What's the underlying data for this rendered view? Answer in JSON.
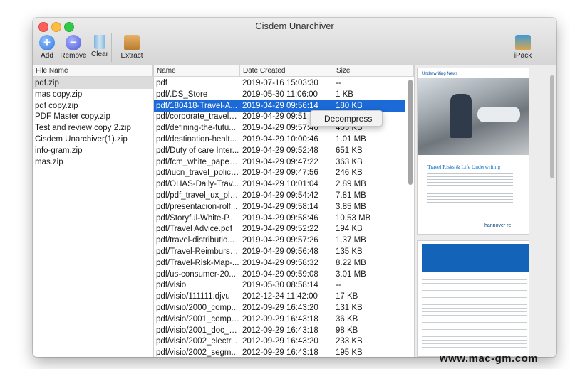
{
  "window": {
    "title": "Cisdem Unarchiver"
  },
  "toolbar": {
    "add_label": "Add",
    "remove_label": "Remove",
    "clear_label": "Clear",
    "extract_label": "Extract",
    "ipack_label": "iPack",
    "add_glyph": "+",
    "remove_glyph": "−"
  },
  "left": {
    "header": "File Name",
    "items": [
      "pdf.zip",
      "mas copy.zip",
      "pdf copy.zip",
      "PDF Master copy.zip",
      "Test and review copy 2.zip",
      "Cisdem Unarchiver(1).zip",
      "info-gram.zip",
      "mas.zip"
    ]
  },
  "table": {
    "headers": {
      "name": "Name",
      "date": "Date Created",
      "size": "Size"
    },
    "rows": [
      [
        "pdf",
        "2019-07-16 15:03:30",
        "--"
      ],
      [
        "pdf/.DS_Store",
        "2019-05-30 11:06:00",
        "1 KB"
      ],
      [
        "pdf/180418-Travel-A...",
        "2019-04-29 09:56:14",
        "180 KB"
      ],
      [
        "pdf/corporate_travelg...",
        "2019-04-29 09:51",
        ""
      ],
      [
        "pdf/defining-the-futu...",
        "2019-04-29 09:57:46",
        "405 KB"
      ],
      [
        "pdf/destination-healt...",
        "2019-04-29 10:00:46",
        "1.01 MB"
      ],
      [
        "pdf/Duty of care Inter...",
        "2019-04-29 09:52:48",
        "651 KB"
      ],
      [
        "pdf/fcm_white_paper_...",
        "2019-04-29 09:47:22",
        "363 KB"
      ],
      [
        "pdf/iucn_travel_policy...",
        "2019-04-29 09:47:56",
        "246 KB"
      ],
      [
        "pdf/OHAS-Daily-Trav...",
        "2019-04-29 10:01:04",
        "2.89 MB"
      ],
      [
        "pdf/pdf_travel_ux_pla...",
        "2019-04-29 09:54:42",
        "7.81 MB"
      ],
      [
        "pdf/presentacion-rolf...",
        "2019-04-29 09:58:14",
        "3.85 MB"
      ],
      [
        "pdf/Storyful-White-P...",
        "2019-04-29 09:58:46",
        "10.53 MB"
      ],
      [
        "pdf/Travel Advice.pdf",
        "2019-04-29 09:52:22",
        "194 KB"
      ],
      [
        "pdf/travel-distributio...",
        "2019-04-29 09:57:26",
        "1.37 MB"
      ],
      [
        "pdf/Travel-Reimburse...",
        "2019-04-29 09:56:48",
        "135 KB"
      ],
      [
        "pdf/Travel-Risk-Map-...",
        "2019-04-29 09:58:32",
        "8.22 MB"
      ],
      [
        "pdf/us-consumer-20...",
        "2019-04-29 09:59:08",
        "3.01 MB"
      ],
      [
        "pdf/visio",
        "2019-05-30 08:58:14",
        "--"
      ],
      [
        "pdf/visio/111111.djvu",
        "2012-12-24 11:42:00",
        "17 KB"
      ],
      [
        "pdf/visio/2000_comp...",
        "2012-09-29 16:43:20",
        "131 KB"
      ],
      [
        "pdf/visio/2001_compr...",
        "2012-09-29 16:43:18",
        "36 KB"
      ],
      [
        "pdf/visio/2001_doc_b...",
        "2012-09-29 16:43:18",
        "98 KB"
      ],
      [
        "pdf/visio/2002_electr...",
        "2012-09-29 16:43:20",
        "233 KB"
      ],
      [
        "pdf/visio/2002_segm...",
        "2012-09-29 16:43:18",
        "195 KB"
      ]
    ]
  },
  "context_menu": {
    "item": "Decompress"
  },
  "preview": {
    "page1_header": "Underwriting News",
    "page1_brand": "hannover re",
    "page1_heading": "Travel Risks & Life Underwriting"
  },
  "watermark": "www.mac-gm.com",
  "colors": {
    "selection_blue": "#1b6ad7",
    "selection_grey": "#dcdcdc",
    "accent": "#2f76de"
  }
}
